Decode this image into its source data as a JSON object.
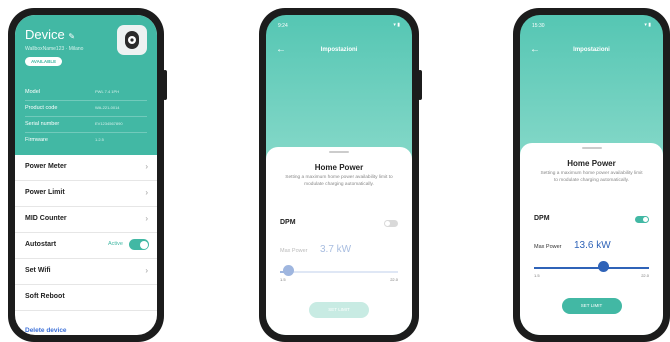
{
  "device": {
    "title": "Device",
    "subtitle": "WallboxName123 · Milano",
    "badge": "AVAILABLE",
    "info": [
      {
        "key": "Model",
        "value": "PWL 7.4 1PH"
      },
      {
        "key": "Product code",
        "value": "WA-221-0014"
      },
      {
        "key": "Serial number",
        "value": "EV1234567890"
      },
      {
        "key": "Firmware",
        "value": "1.2.5"
      }
    ],
    "menu": [
      {
        "label": "Power Meter"
      },
      {
        "label": "Power Limit"
      },
      {
        "label": "MID Counter"
      },
      {
        "label": "Autostart",
        "status": "Active"
      },
      {
        "label": "Set Wifi"
      },
      {
        "label": "Soft Reboot"
      }
    ],
    "delete_label": "Delete device"
  },
  "screens": [
    {
      "time": "9:24",
      "title": "Impostazioni",
      "sheet_title": "Home Power",
      "sheet_desc": "Setting a maximum home power availability limit to modulate charging automatically.",
      "dpm_label": "DPM",
      "dpm_enabled": false,
      "max_power_label": "Max Power",
      "max_power_value": "3.7 kW",
      "slider_fraction": 0.07,
      "slider_min": "1.5",
      "slider_max": "22.0",
      "button_label": "SET LIMIT",
      "button_enabled": false
    },
    {
      "time": "15:30",
      "title": "Impostazioni",
      "sheet_title": "Home Power",
      "sheet_desc": "Setting a maximum home power availability limit to modulate charging automatically.",
      "dpm_label": "DPM",
      "dpm_enabled": true,
      "max_power_label": "Max Power",
      "max_power_value": "13.6 kW",
      "slider_fraction": 0.6,
      "slider_min": "1.5",
      "slider_max": "22.0",
      "button_label": "SET LIMIT",
      "button_enabled": true
    }
  ],
  "colors": {
    "accent": "#42b8a4",
    "accent_light": "#a9e3d8",
    "value_blue": "#2f63b8"
  }
}
